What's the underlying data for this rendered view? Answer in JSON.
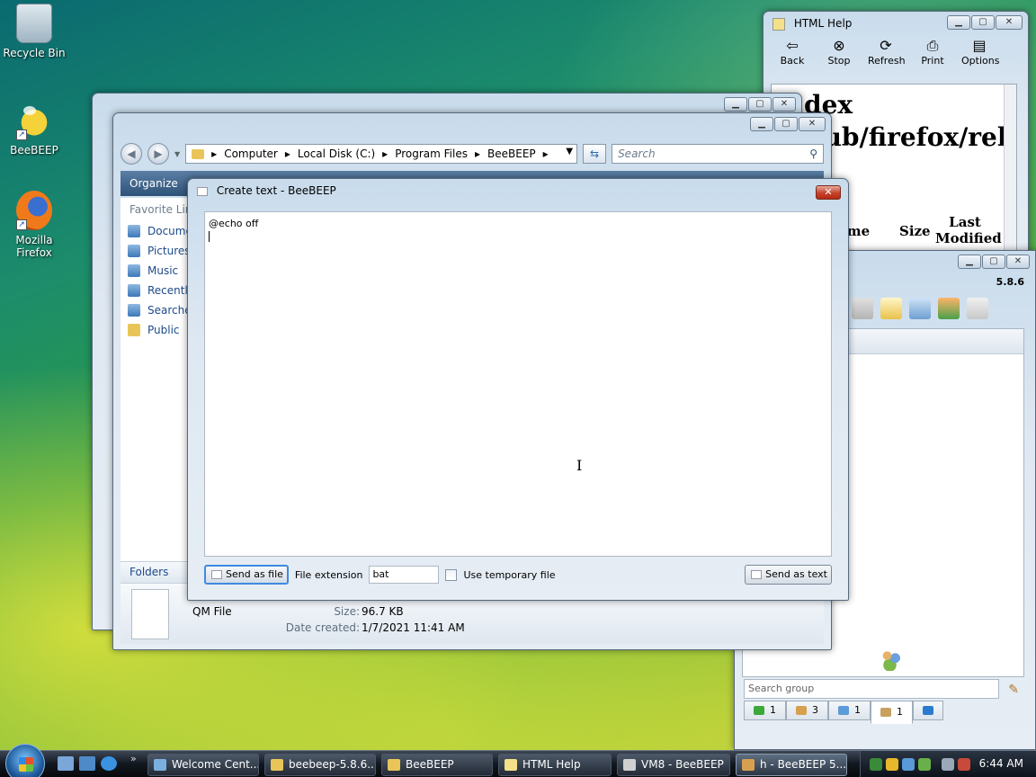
{
  "desktop": {
    "icons": [
      {
        "label": "Recycle Bin"
      },
      {
        "label": "BeeBEEP"
      },
      {
        "label": "Mozilla Firefox"
      }
    ]
  },
  "help_window": {
    "title": "HTML Help",
    "toolbar": [
      "Back",
      "Stop",
      "Refresh",
      "Print",
      "Options"
    ],
    "content_lines": [
      "dex",
      "pub/firefox/rele"
    ],
    "columns": [
      "ame",
      "Size",
      "Last Modified"
    ]
  },
  "beebeep_main": {
    "version": "5.8.6",
    "search_placeholder": "Search group",
    "tabs": [
      {
        "count": "1"
      },
      {
        "count": "3"
      },
      {
        "count": "1"
      },
      {
        "count": "1"
      }
    ]
  },
  "explorer": {
    "breadcrumb": [
      "Computer",
      "Local Disk (C:)",
      "Program Files",
      "BeeBEEP"
    ],
    "search_placeholder": "Search",
    "organize": "Organize",
    "favorites_header": "Favorite Links",
    "favorites": [
      "Documents",
      "Pictures",
      "Music",
      "Recently Changed",
      "Searches",
      "Public"
    ],
    "folders_label": "Folders",
    "details": {
      "type": "QM File",
      "size_label": "Size:",
      "size": "96.7 KB",
      "created_label": "Date created:",
      "created": "1/7/2021 11:41 AM"
    }
  },
  "dialog": {
    "title": "Create text - BeeBEEP",
    "text": "@echo off",
    "send_as_file": "Send as file",
    "file_extension_label": "File extension",
    "file_extension_value": "bat",
    "use_temp_label": "Use temporary file",
    "send_as_text": "Send as text"
  },
  "taskbar": {
    "tasks": [
      "Welcome Cent...",
      "beebeep-5.8.6...",
      "BeeBEEP",
      "HTML Help",
      "VM8 - BeeBEEP",
      "h - BeeBEEP 5...."
    ],
    "clock": "6:44 AM"
  }
}
